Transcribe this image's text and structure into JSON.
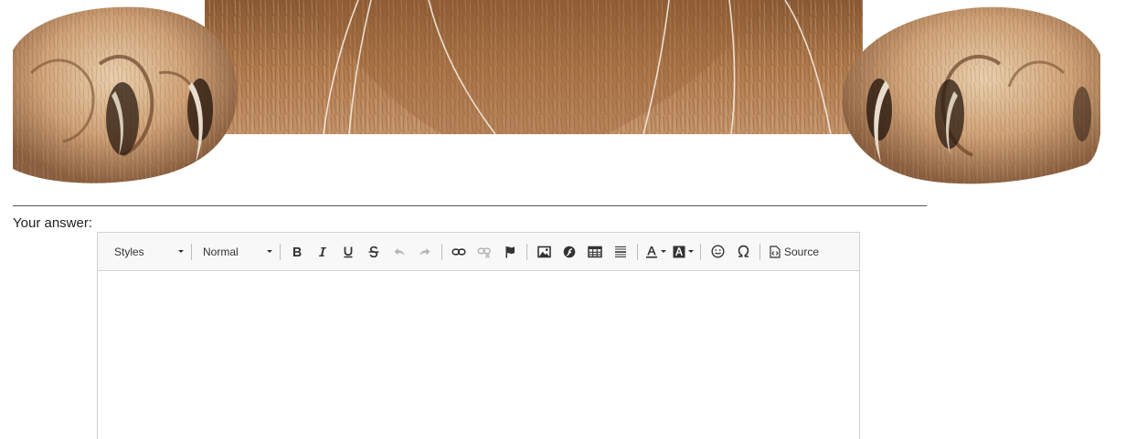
{
  "label": {
    "your_answer": "Your answer:"
  },
  "toolbar": {
    "styles_combo": "Styles",
    "format_combo": "Normal",
    "source_label": "Source",
    "buttons": [
      "bold",
      "italic",
      "underline",
      "strikethrough",
      "undo",
      "redo",
      "link",
      "unlink",
      "anchor",
      "image",
      "flash",
      "table",
      "horizontal-rule",
      "text-color",
      "background-color",
      "emoji",
      "special-character",
      "source"
    ]
  },
  "colors": {
    "toolbar_bg": "#f8f8f8",
    "border": "#d1d1d1",
    "icon": "#333333",
    "icon_disabled": "#b5b5b5",
    "fur_light": "#d9b58a",
    "fur_mid": "#b98150",
    "fur_dark": "#5a3a22"
  }
}
